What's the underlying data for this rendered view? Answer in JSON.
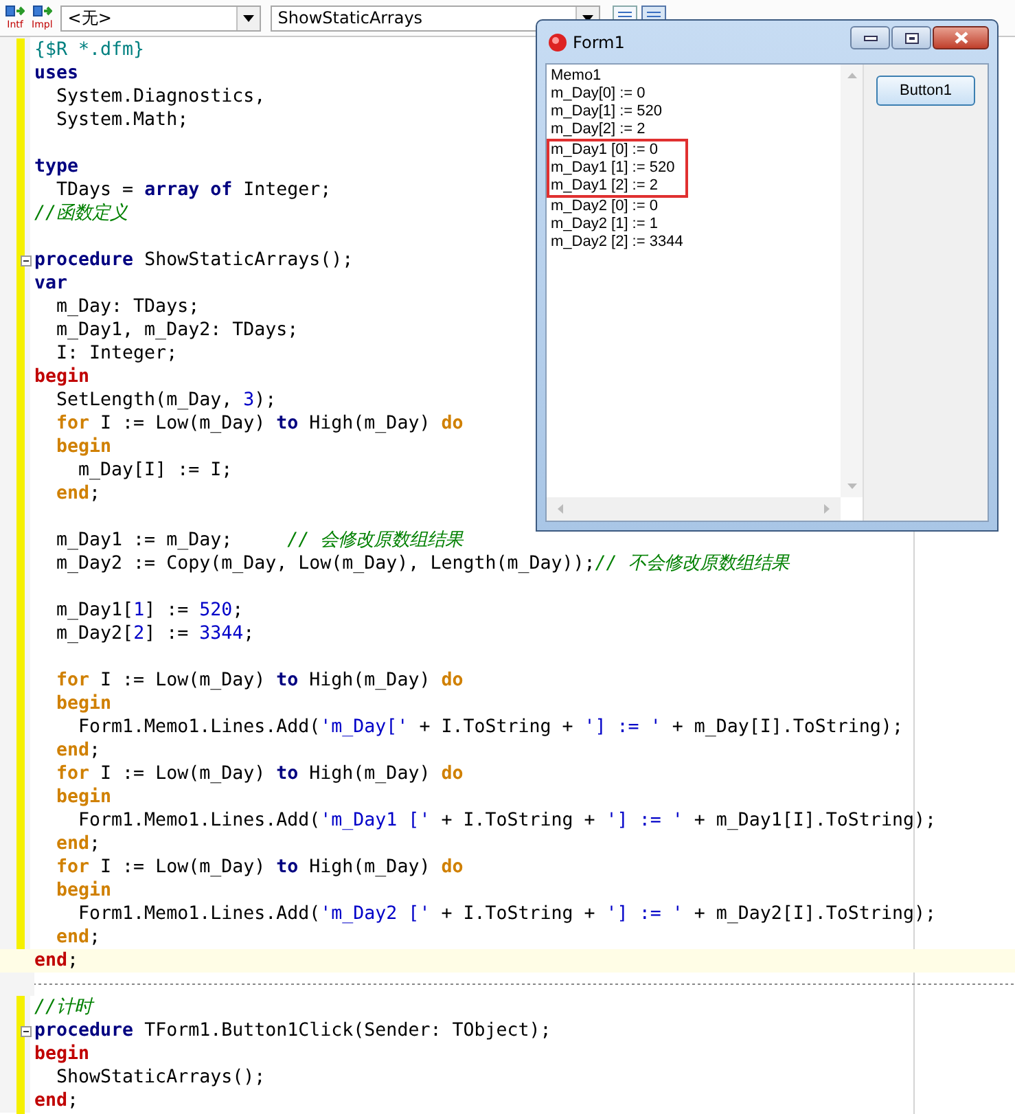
{
  "toolbar": {
    "buttons": [
      {
        "label": "Intf"
      },
      {
        "label": "Impl"
      }
    ],
    "dropdowns": [
      {
        "value": "<无>"
      },
      {
        "value": "ShowStaticArrays"
      }
    ]
  },
  "editor": {
    "lines": [
      {
        "kind": "code",
        "tokens": [
          {
            "kind": "directive",
            "text": "{$R *.dfm}"
          }
        ]
      },
      {
        "kind": "code",
        "tokens": [
          {
            "kind": "keyword",
            "text": "uses"
          }
        ]
      },
      {
        "kind": "code",
        "tokens": [
          {
            "kind": "plain",
            "text": "  System.Diagnostics,"
          }
        ]
      },
      {
        "kind": "code",
        "tokens": [
          {
            "kind": "plain",
            "text": "  System.Math;"
          }
        ]
      },
      {
        "kind": "blank"
      },
      {
        "kind": "code",
        "tokens": [
          {
            "kind": "keyword",
            "text": "type"
          }
        ]
      },
      {
        "kind": "code",
        "tokens": [
          {
            "kind": "plain",
            "text": "  TDays = "
          },
          {
            "kind": "keyword",
            "text": "array of"
          },
          {
            "kind": "plain",
            "text": " Integer;"
          }
        ]
      },
      {
        "kind": "code",
        "tokens": [
          {
            "kind": "comment",
            "text": "//函数定义"
          }
        ]
      },
      {
        "kind": "blank"
      },
      {
        "kind": "code",
        "foldable": true,
        "tokens": [
          {
            "kind": "keyword",
            "text": "procedure"
          },
          {
            "kind": "plain",
            "text": " ShowStaticArrays();"
          }
        ]
      },
      {
        "kind": "code",
        "tokens": [
          {
            "kind": "keyword",
            "text": "var"
          }
        ]
      },
      {
        "kind": "code",
        "tokens": [
          {
            "kind": "plain",
            "text": "  m_Day: TDays;"
          }
        ]
      },
      {
        "kind": "code",
        "tokens": [
          {
            "kind": "plain",
            "text": "  m_Day1, m_Day2: TDays;"
          }
        ]
      },
      {
        "kind": "code",
        "tokens": [
          {
            "kind": "plain",
            "text": "  I: Integer;"
          }
        ]
      },
      {
        "kind": "code",
        "tokens": [
          {
            "kind": "block",
            "text": "begin"
          }
        ]
      },
      {
        "kind": "code",
        "tokens": [
          {
            "kind": "plain",
            "text": "  SetLength(m_Day, "
          },
          {
            "kind": "number",
            "text": "3"
          },
          {
            "kind": "plain",
            "text": ");"
          }
        ]
      },
      {
        "kind": "code",
        "tokens": [
          {
            "kind": "flow",
            "text": "  for"
          },
          {
            "kind": "plain",
            "text": " I := Low(m_Day) "
          },
          {
            "kind": "keyword",
            "text": "to"
          },
          {
            "kind": "plain",
            "text": " High(m_Day) "
          },
          {
            "kind": "flow",
            "text": "do"
          }
        ]
      },
      {
        "kind": "code",
        "tokens": [
          {
            "kind": "flow",
            "text": "  begin"
          }
        ]
      },
      {
        "kind": "code",
        "tokens": [
          {
            "kind": "plain",
            "text": "    m_Day[I] := I;"
          }
        ]
      },
      {
        "kind": "code",
        "tokens": [
          {
            "kind": "flow",
            "text": "  end"
          },
          {
            "kind": "plain",
            "text": ";"
          }
        ]
      },
      {
        "kind": "blank"
      },
      {
        "kind": "code",
        "tokens": [
          {
            "kind": "plain",
            "text": "  m_Day1 := m_Day;     "
          },
          {
            "kind": "comment",
            "text": "// 会修改原数组结果"
          }
        ]
      },
      {
        "kind": "code",
        "tokens": [
          {
            "kind": "plain",
            "text": "  m_Day2 := Copy(m_Day, Low(m_Day), Length(m_Day));"
          },
          {
            "kind": "comment",
            "text": "// 不会修改原数组结果"
          }
        ]
      },
      {
        "kind": "blank"
      },
      {
        "kind": "code",
        "tokens": [
          {
            "kind": "plain",
            "text": "  m_Day1["
          },
          {
            "kind": "number",
            "text": "1"
          },
          {
            "kind": "plain",
            "text": "] := "
          },
          {
            "kind": "number",
            "text": "520"
          },
          {
            "kind": "plain",
            "text": ";"
          }
        ]
      },
      {
        "kind": "code",
        "tokens": [
          {
            "kind": "plain",
            "text": "  m_Day2["
          },
          {
            "kind": "number",
            "text": "2"
          },
          {
            "kind": "plain",
            "text": "] := "
          },
          {
            "kind": "number",
            "text": "3344"
          },
          {
            "kind": "plain",
            "text": ";"
          }
        ]
      },
      {
        "kind": "blank"
      },
      {
        "kind": "code",
        "tokens": [
          {
            "kind": "flow",
            "text": "  for"
          },
          {
            "kind": "plain",
            "text": " I := Low(m_Day) "
          },
          {
            "kind": "keyword",
            "text": "to"
          },
          {
            "kind": "plain",
            "text": " High(m_Day) "
          },
          {
            "kind": "flow",
            "text": "do"
          }
        ]
      },
      {
        "kind": "code",
        "tokens": [
          {
            "kind": "flow",
            "text": "  begin"
          }
        ]
      },
      {
        "kind": "code",
        "tokens": [
          {
            "kind": "plain",
            "text": "    Form1.Memo1.Lines.Add("
          },
          {
            "kind": "string",
            "text": "'m_Day['"
          },
          {
            "kind": "plain",
            "text": " + I.ToString + "
          },
          {
            "kind": "string",
            "text": "'] := '"
          },
          {
            "kind": "plain",
            "text": " + m_Day[I].ToString);"
          }
        ]
      },
      {
        "kind": "code",
        "tokens": [
          {
            "kind": "flow",
            "text": "  end"
          },
          {
            "kind": "plain",
            "text": ";"
          }
        ]
      },
      {
        "kind": "code",
        "tokens": [
          {
            "kind": "flow",
            "text": "  for"
          },
          {
            "kind": "plain",
            "text": " I := Low(m_Day) "
          },
          {
            "kind": "keyword",
            "text": "to"
          },
          {
            "kind": "plain",
            "text": " High(m_Day) "
          },
          {
            "kind": "flow",
            "text": "do"
          }
        ]
      },
      {
        "kind": "code",
        "tokens": [
          {
            "kind": "flow",
            "text": "  begin"
          }
        ]
      },
      {
        "kind": "code",
        "tokens": [
          {
            "kind": "plain",
            "text": "    Form1.Memo1.Lines.Add("
          },
          {
            "kind": "string",
            "text": "'m_Day1 ['"
          },
          {
            "kind": "plain",
            "text": " + I.ToString + "
          },
          {
            "kind": "string",
            "text": "'] := '"
          },
          {
            "kind": "plain",
            "text": " + m_Day1[I].ToString);"
          }
        ]
      },
      {
        "kind": "code",
        "tokens": [
          {
            "kind": "flow",
            "text": "  end"
          },
          {
            "kind": "plain",
            "text": ";"
          }
        ]
      },
      {
        "kind": "code",
        "tokens": [
          {
            "kind": "flow",
            "text": "  for"
          },
          {
            "kind": "plain",
            "text": " I := Low(m_Day) "
          },
          {
            "kind": "keyword",
            "text": "to"
          },
          {
            "kind": "plain",
            "text": " High(m_Day) "
          },
          {
            "kind": "flow",
            "text": "do"
          }
        ]
      },
      {
        "kind": "code",
        "tokens": [
          {
            "kind": "flow",
            "text": "  begin"
          }
        ]
      },
      {
        "kind": "code",
        "tokens": [
          {
            "kind": "plain",
            "text": "    Form1.Memo1.Lines.Add("
          },
          {
            "kind": "string",
            "text": "'m_Day2 ['"
          },
          {
            "kind": "plain",
            "text": " + I.ToString + "
          },
          {
            "kind": "string",
            "text": "'] := '"
          },
          {
            "kind": "plain",
            "text": " + m_Day2[I].ToString);"
          }
        ]
      },
      {
        "kind": "code",
        "tokens": [
          {
            "kind": "flow",
            "text": "  end"
          },
          {
            "kind": "plain",
            "text": ";"
          }
        ]
      },
      {
        "kind": "code",
        "current": true,
        "tokens": [
          {
            "kind": "block",
            "text": "end"
          },
          {
            "kind": "plain",
            "text": ";"
          }
        ]
      },
      {
        "kind": "separator"
      },
      {
        "kind": "code",
        "tokens": [
          {
            "kind": "comment",
            "text": "//计时"
          }
        ]
      },
      {
        "kind": "code",
        "foldable": true,
        "tokens": [
          {
            "kind": "keyword",
            "text": "procedure"
          },
          {
            "kind": "plain",
            "text": " TForm1.Button1Click(Sender: TObject);"
          }
        ]
      },
      {
        "kind": "code",
        "tokens": [
          {
            "kind": "block",
            "text": "begin"
          }
        ]
      },
      {
        "kind": "code",
        "tokens": [
          {
            "kind": "plain",
            "text": "  ShowStaticArrays();"
          }
        ]
      },
      {
        "kind": "code",
        "tokens": [
          {
            "kind": "block",
            "text": "end"
          },
          {
            "kind": "plain",
            "text": ";"
          }
        ]
      }
    ]
  },
  "form_window": {
    "title": "Form1",
    "memo": {
      "lines": [
        {
          "text": "Memo1",
          "boxed": false
        },
        {
          "text": "m_Day[0] := 0",
          "boxed": false
        },
        {
          "text": "m_Day[1] := 520",
          "boxed": false
        },
        {
          "text": "m_Day[2] := 2",
          "boxed": false
        },
        {
          "text": "m_Day1 [0] := 0",
          "boxed": true
        },
        {
          "text": "m_Day1 [1] := 520",
          "boxed": true
        },
        {
          "text": "m_Day1 [2] := 2",
          "boxed": true
        },
        {
          "text": "m_Day2 [0] := 0",
          "boxed": false
        },
        {
          "text": "m_Day2 [1] := 1",
          "boxed": false
        },
        {
          "text": "m_Day2 [2] := 3344",
          "boxed": false
        }
      ]
    },
    "button": "Button1"
  }
}
